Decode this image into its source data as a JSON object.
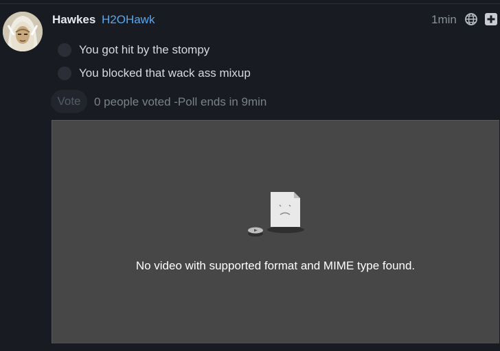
{
  "post": {
    "author_name": "Hawkes",
    "author_handle": "H2OHawk",
    "timestamp": "1min",
    "visibility_icon": "globe-icon",
    "action_icon": "plus-square-icon"
  },
  "poll": {
    "options": [
      {
        "label": "You got hit by the stompy",
        "selected": false
      },
      {
        "label": "You blocked that wack ass mixup",
        "selected": false
      }
    ],
    "vote_button_label": "Vote",
    "meta_text": "0 people voted -Poll ends in 9min"
  },
  "media": {
    "error_message": "No video with supported format and MIME type found.",
    "error_icon": "broken-video-file-icon"
  },
  "colors": {
    "background": "#191b22",
    "handle": "#5aa8ef",
    "video_background": "#474747"
  }
}
